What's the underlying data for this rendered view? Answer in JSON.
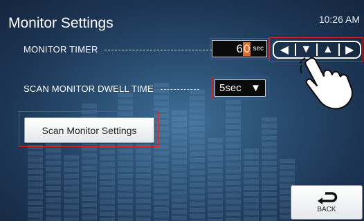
{
  "header": {
    "title": "Monitor Settings",
    "time": "10:26 AM"
  },
  "monitor_timer": {
    "label": "MONITOR TIMER",
    "value_digit1": "6",
    "value_digit2": "0",
    "unit": "sec",
    "arrows": {
      "left": "◀",
      "down": "▼",
      "up": "▲",
      "right": "▶"
    }
  },
  "dwell_time": {
    "label": "SCAN MONITOR DWELL TIME",
    "value": "5sec",
    "dropdown_glyph": "▼"
  },
  "buttons": {
    "scan_settings": "Scan Monitor Settings",
    "back": "BACK"
  },
  "icons": {
    "back": "return-arrow-icon",
    "pointer": "pointing-hand-icon"
  },
  "colors": {
    "highlight": "#e52020",
    "digit_edit": "#e86a1f"
  }
}
